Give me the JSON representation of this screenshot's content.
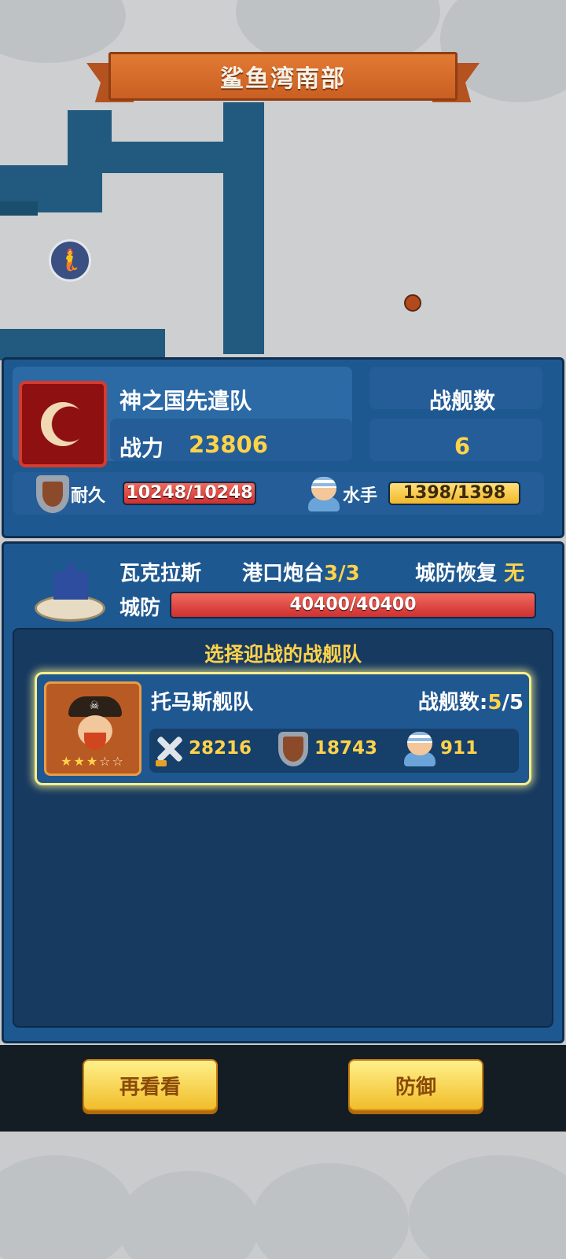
{
  "map": {
    "region_title": "鲨鱼湾南部",
    "markers": [
      {
        "icon": "mermaid-icon"
      },
      {
        "icon": "port-dot-icon"
      }
    ]
  },
  "fleet": {
    "emblem_icon": "crescent-moon-icon",
    "name": "神之国先遣队",
    "power_label": "战力",
    "power_value": "23806",
    "ships_label": "战舰数",
    "ships_value": "6",
    "durability_label": "耐久",
    "durability_text": "10248/10248",
    "durability_fraction": 1.0,
    "sailors_label": "水手",
    "sailors_text": "1398/1398",
    "sailors_fraction": 1.0
  },
  "city": {
    "name": "瓦克拉斯",
    "battery_label": "港口炮台",
    "battery_value": "3/3",
    "recover_label": "城防恢复",
    "recover_value": "无",
    "defense_label": "城防",
    "defense_text": "40400/40400",
    "defense_fraction": 1.0
  },
  "selection": {
    "title": "选择迎战的战舰队",
    "squads": [
      {
        "name": "托马斯舰队",
        "ships_label": "战舰数:",
        "ships_current": "5",
        "ships_total": "/5",
        "stars_filled": 3,
        "stars_total": 5,
        "attack": "28216",
        "defense": "18743",
        "sailors": "911"
      }
    ]
  },
  "buttons": {
    "back_label": "再看看",
    "defend_label": "防御"
  },
  "colors": {
    "panel_blue": "#1e5890",
    "accent_gold": "#ffd24a",
    "bar_red": "#cf3030",
    "bar_gold": "#f1b82b",
    "banner_orange": "#c95f22"
  }
}
